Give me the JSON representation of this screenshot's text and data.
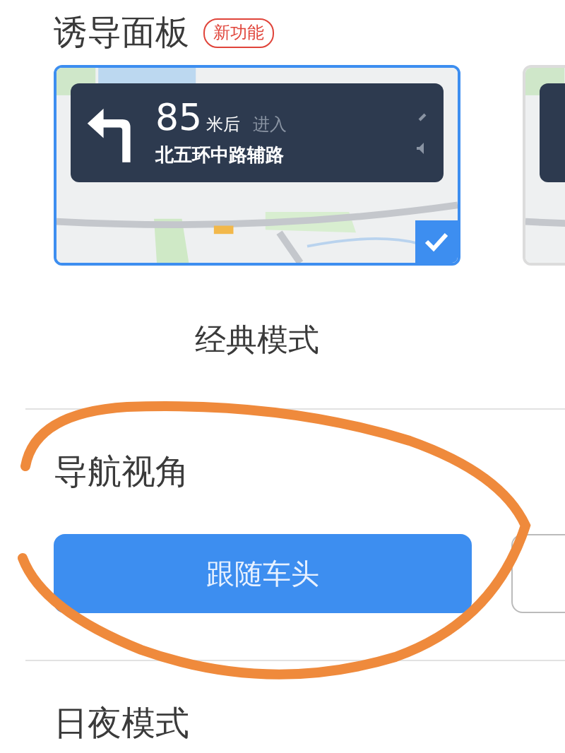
{
  "sections": [
    {
      "kind": "panel-picker",
      "title": "诱导面板",
      "badge": "新功能",
      "options": [
        {
          "selected": true,
          "caption": "经典模式",
          "preview": {
            "distance": "85",
            "unit": "米后",
            "action": "进入",
            "road": "北五环中路辅路"
          }
        },
        {
          "selected": false
        }
      ]
    },
    {
      "kind": "button-choice",
      "title": "导航视角",
      "options": [
        {
          "label": "跟随车头",
          "selected": true
        },
        {
          "selected": false
        }
      ]
    },
    {
      "kind": "plain",
      "title": "日夜模式"
    }
  ]
}
